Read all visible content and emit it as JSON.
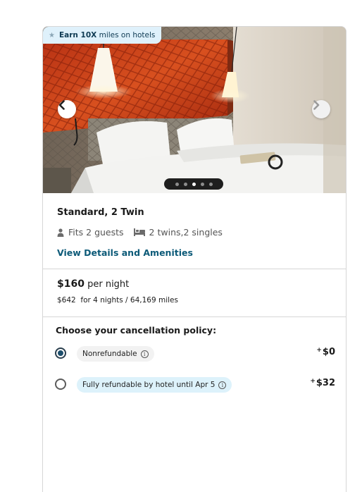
{
  "badge": {
    "icon": "star-icon",
    "bold": "Earn 10X",
    "rest": " miles on hotels"
  },
  "gallery": {
    "prev_icon": "chevron-left-icon",
    "next_icon": "chevron-right-icon",
    "dot_count": 5,
    "active_dot": 3
  },
  "room": {
    "name": "Standard, 2 Twin",
    "guests_icon": "person-icon",
    "guests": "Fits 2 guests",
    "beds_icon": "bed-icon",
    "beds": "2 twins,2 singles",
    "details_link": "View Details and Amenities"
  },
  "price": {
    "amount": "$160",
    "unit": " per night",
    "total": "$642",
    "total_suffix": "  for 4 nights / 64,169 miles"
  },
  "cancellation": {
    "title": "Choose your cancellation policy:",
    "options": [
      {
        "label": "Nonrefundable",
        "sign": "+",
        "price": "$0",
        "selected": true
      },
      {
        "label": "Fully refundable by hotel until Apr 5",
        "sign": "+",
        "price": "$32",
        "selected": false
      }
    ]
  },
  "colors": {
    "link": "#0c5a78",
    "badge_bg": "#dff1fb",
    "radio_selected": "#1d4e6c"
  }
}
